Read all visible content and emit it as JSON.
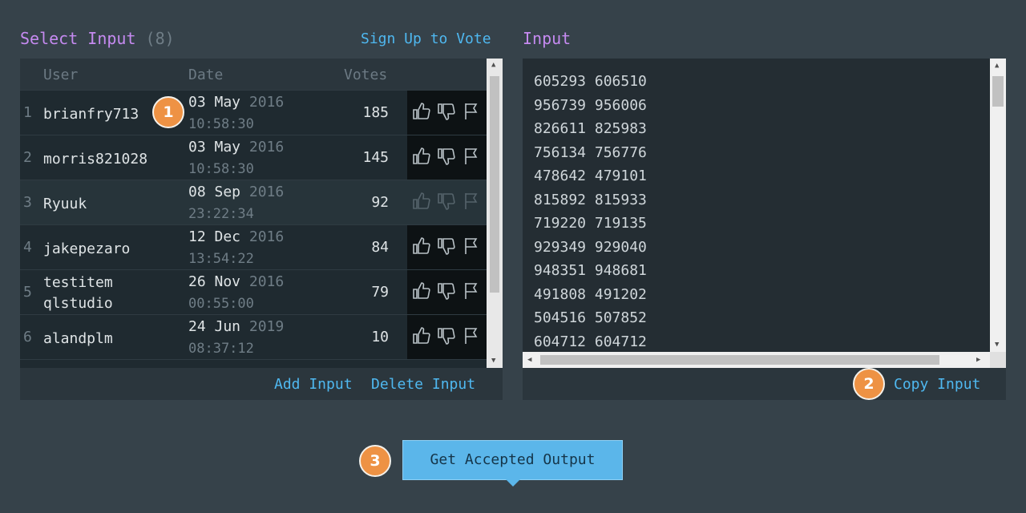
{
  "left_panel": {
    "title": "Select Input",
    "count": "(8)",
    "signup_link": "Sign Up to Vote",
    "columns": {
      "user": "User",
      "date": "Date",
      "votes": "Votes"
    },
    "rows": [
      {
        "index": "1",
        "user": "brianfry713",
        "date": "03 May",
        "year": "2016",
        "time": "10:58:30",
        "votes": "185"
      },
      {
        "index": "2",
        "user": "morris821028",
        "date": "03 May",
        "year": "2016",
        "time": "10:58:30",
        "votes": "145"
      },
      {
        "index": "3",
        "user": "Ryuuk",
        "date": "08 Sep",
        "year": "2016",
        "time": "23:22:34",
        "votes": "92"
      },
      {
        "index": "4",
        "user": "jakepezaro",
        "date": "12 Dec",
        "year": "2016",
        "time": "13:54:22",
        "votes": "84"
      },
      {
        "index": "5",
        "user_line1": "testitem",
        "user_line2": "qlstudio",
        "date": "26 Nov",
        "year": "2016",
        "time": "00:55:00",
        "votes": "79"
      },
      {
        "index": "6",
        "user": "alandplm",
        "date": "24 Jun",
        "year": "2019",
        "time": "08:37:12",
        "votes": "10"
      }
    ],
    "footer": {
      "add": "Add Input",
      "delete": "Delete Input"
    }
  },
  "right_panel": {
    "title": "Input",
    "lines": [
      "605293 606510",
      "956739 956006",
      "826611 825983",
      "756134 756776",
      "478642 479101",
      "815892 815933",
      "719220 719135",
      "929349 929040",
      "948351 948681",
      "491808 491202",
      "504516 507852",
      "604712 604712"
    ],
    "copy_button": "Copy Input"
  },
  "badges": {
    "one": "1",
    "two": "2",
    "three": "3"
  },
  "main_button": "Get Accepted Output",
  "colors": {
    "background": "#36424a",
    "title_purple": "#c58af0",
    "link_blue": "#4fb8f0",
    "badge_orange": "#ee9244",
    "button_blue": "#5bb6ea"
  },
  "icons": {
    "upvote": "thumbs-up-icon",
    "downvote": "thumbs-down-icon",
    "flag": "flag-icon"
  }
}
